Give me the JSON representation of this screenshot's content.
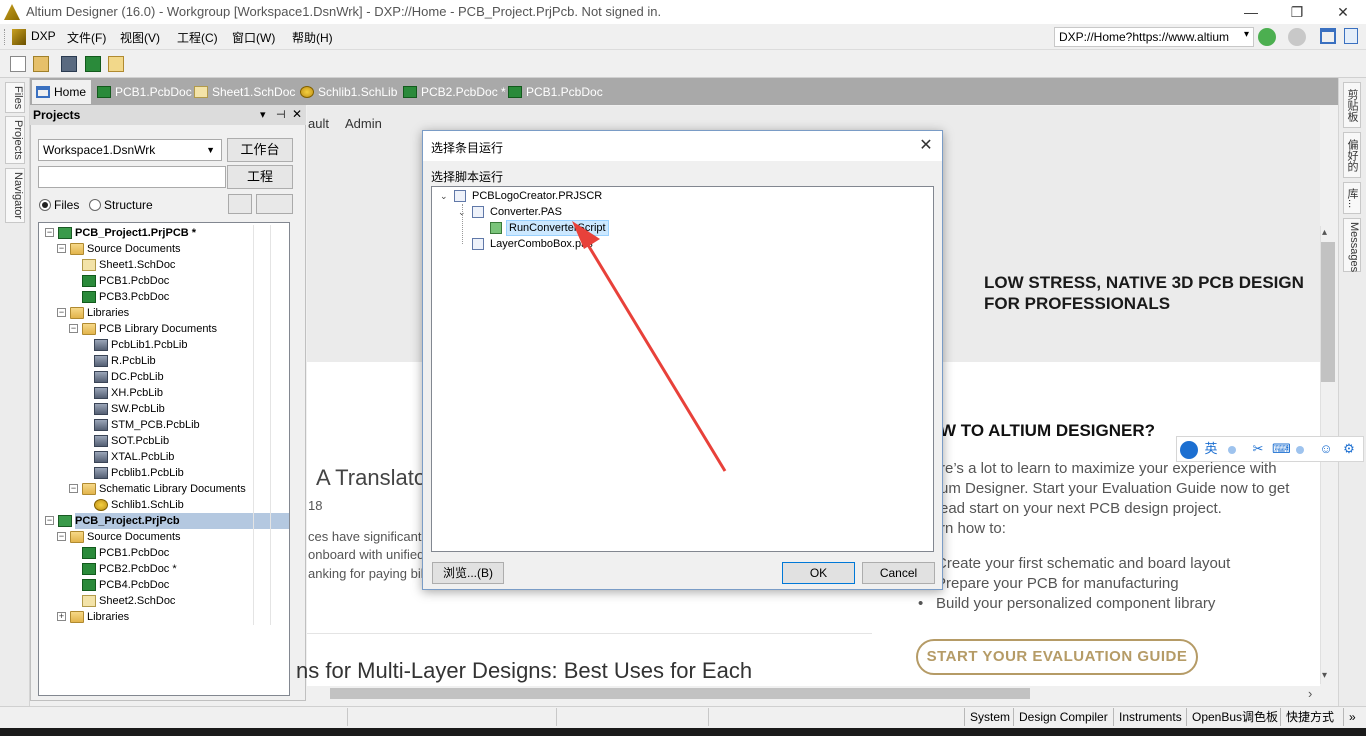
{
  "window": {
    "title": "Altium Designer (16.0) - Workgroup [Workspace1.DsnWrk] - DXP://Home - PCB_Project.PrjPcb. Not signed in.",
    "min_glyph": "—",
    "restore_glyph": "❐",
    "close_glyph": "✕"
  },
  "menu": {
    "items": [
      "DXP",
      "文件(F)",
      "视图(V)",
      "工程(C)",
      "窗口(W)",
      "帮助(H)"
    ],
    "address": "DXP://Home?https://www.altium",
    "address_arrow": "▾"
  },
  "left_strip": {
    "tabs": [
      "Files",
      "Projects",
      "Navigator"
    ]
  },
  "right_strip": {
    "tabs": [
      "剪贴板",
      "偏好的",
      "库...",
      "Messages"
    ]
  },
  "tabs": [
    {
      "label": "Home",
      "icon": "home-icon",
      "active": true
    },
    {
      "label": "PCB1.PcbDoc",
      "icon": "pcb-doc-icon"
    },
    {
      "label": "Sheet1.SchDoc",
      "icon": "sch-doc-icon"
    },
    {
      "label": "Schlib1.SchLib",
      "icon": "schlib-icon"
    },
    {
      "label": "PCB2.PcbDoc *",
      "icon": "pcb-doc-icon"
    },
    {
      "label": "PCB1.PcbDoc",
      "icon": "pcb-doc-icon"
    }
  ],
  "projects_panel": {
    "title": "Projects",
    "header_glyphs": [
      "▾",
      "⊣",
      "✕"
    ],
    "workspace": "Workspace1.DsnWrk",
    "workspace_button": "工作台",
    "project_button": "工程",
    "radio_files": "Files",
    "radio_structure": "Structure",
    "tree": [
      {
        "label": "PCB_Project1.PrjPCB *",
        "level": 0,
        "icon": "project",
        "expander": "−",
        "bold": true
      },
      {
        "label": "Source Documents",
        "level": 1,
        "icon": "folder",
        "expander": "−"
      },
      {
        "label": "Sheet1.SchDoc",
        "level": 2,
        "icon": "sch"
      },
      {
        "label": "PCB1.PcbDoc",
        "level": 2,
        "icon": "pcb"
      },
      {
        "label": "PCB3.PcbDoc",
        "level": 2,
        "icon": "pcb"
      },
      {
        "label": "Libraries",
        "level": 1,
        "icon": "folder",
        "expander": "−"
      },
      {
        "label": "PCB Library Documents",
        "level": 2,
        "icon": "folder",
        "expander": "−"
      },
      {
        "label": "PcbLib1.PcbLib",
        "level": 3,
        "icon": "lib"
      },
      {
        "label": "R.PcbLib",
        "level": 3,
        "icon": "lib"
      },
      {
        "label": "DC.PcbLib",
        "level": 3,
        "icon": "lib"
      },
      {
        "label": "XH.PcbLib",
        "level": 3,
        "icon": "lib"
      },
      {
        "label": "SW.PcbLib",
        "level": 3,
        "icon": "lib"
      },
      {
        "label": "STM_PCB.PcbLib",
        "level": 3,
        "icon": "lib"
      },
      {
        "label": "SOT.PcbLib",
        "level": 3,
        "icon": "lib"
      },
      {
        "label": "XTAL.PcbLib",
        "level": 3,
        "icon": "lib"
      },
      {
        "label": "Pcblib1.PcbLib",
        "level": 3,
        "icon": "lib"
      },
      {
        "label": "Schematic Library Documents",
        "level": 2,
        "icon": "folder",
        "expander": "−"
      },
      {
        "label": "Schlib1.SchLib",
        "level": 3,
        "icon": "schlib"
      },
      {
        "label": "PCB_Project.PrjPcb",
        "level": 0,
        "icon": "project",
        "expander": "−",
        "bold": true,
        "selected": true
      },
      {
        "label": "Source Documents",
        "level": 1,
        "icon": "folder",
        "expander": "−"
      },
      {
        "label": "PCB1.PcbDoc",
        "level": 2,
        "icon": "pcb"
      },
      {
        "label": "PCB2.PcbDoc *",
        "level": 2,
        "icon": "pcb"
      },
      {
        "label": "PCB4.PcbDoc",
        "level": 2,
        "icon": "pcb"
      },
      {
        "label": "Sheet2.SchDoc",
        "level": 2,
        "icon": "sch"
      },
      {
        "label": "Libraries",
        "level": 1,
        "icon": "folder",
        "expander": "+"
      }
    ]
  },
  "home": {
    "links": [
      "ault",
      "Admin"
    ],
    "hero": [
      "LOW STRESS, NATIVE 3D PCB DESIGN",
      "FOR PROFESSIONALS"
    ],
    "howto_title": "W TO ALTIUM DESIGNER?",
    "intro": [
      "re’s a lot to learn to maximize your experience with",
      "um Designer. Start your Evaluation Guide now to get",
      "ead start on your next PCB design project.",
      "rn how to:"
    ],
    "bullets": [
      "Create your first schematic and board layout",
      "Prepare your PCB for manufacturing",
      "Build your personalized component library"
    ],
    "bullet_glyph": "•",
    "eval_button": "START YOUR EVALUATION GUIDE",
    "article1_title": "A Translator",
    "article1_date": "18",
    "article1_snippet": [
      "ces have significant",
      "onboard with unified",
      "anking for paying bil"
    ],
    "article2_title": "ns for Multi-Layer Designs: Best Uses for Each"
  },
  "ime": {
    "lang_label": "英",
    "glyphs": [
      "⌨",
      "⇧",
      "☺"
    ]
  },
  "scroll_glyphs": {
    "up": "▴",
    "down": "▾",
    "right": "›"
  },
  "status_bar": {
    "items": [
      "System",
      "Design Compiler",
      "Instruments",
      "OpenBus调色板",
      "快捷方式"
    ],
    "more": "»"
  },
  "dialog": {
    "title": "选择条目运行",
    "close_glyph": "✕",
    "label": "选择脚本运行",
    "tree": [
      {
        "label": "PCBLogoCreator.PRJSCR",
        "level": 0,
        "icon": "project",
        "arrow": "⌄"
      },
      {
        "label": "Converter.PAS",
        "level": 1,
        "icon": "script",
        "arrow": "⌄"
      },
      {
        "label": "RunConverterScript",
        "level": 2,
        "icon": "run",
        "selected": true
      },
      {
        "label": "LayerComboBox.pas",
        "level": 1,
        "icon": "script"
      }
    ],
    "browse_button": "浏览...(B)",
    "ok_button": "OK",
    "cancel_button": "Cancel"
  },
  "colors": {
    "accent": "#0078d7",
    "annotation_arrow": "#e8413a",
    "eval_gold": "#b59b66",
    "selection": "#b4c8e0"
  }
}
